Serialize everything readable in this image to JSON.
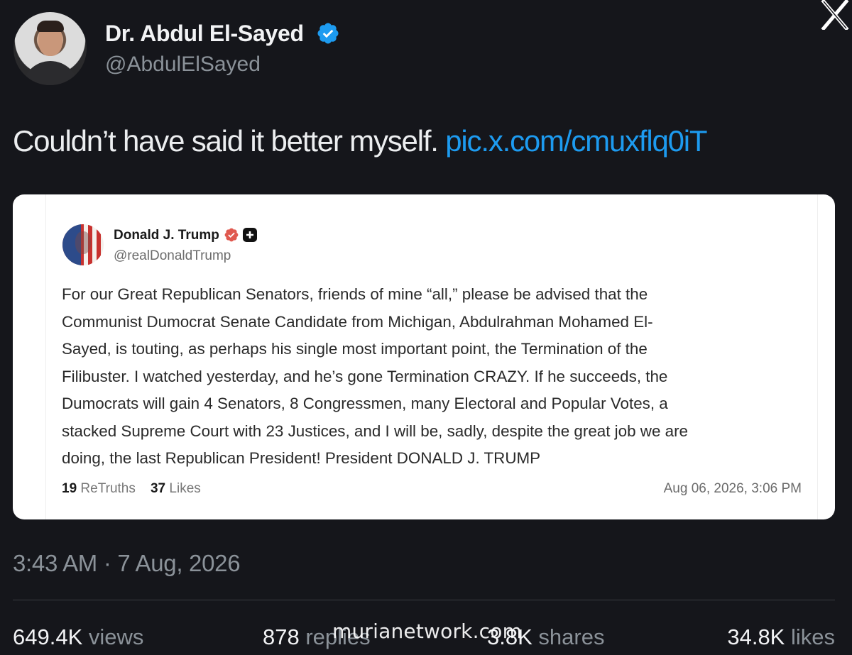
{
  "author": {
    "display_name": "Dr. Abdul El-Sayed",
    "handle": "@AbdulElSayed",
    "verified_icon": "verified-check-icon",
    "verified_color": "#1d9bf0"
  },
  "app_logo": "x-logo-icon",
  "tweet": {
    "text": "Couldn’t have said it better myself.",
    "link": "pic.x.com/cmuxflq0iT",
    "link_color": "#1d9bf0"
  },
  "embedded_post": {
    "display_name": "Donald J. Trump",
    "handle": "@realDonaldTrump",
    "badge_color": "#e0594f",
    "body_lines": [
      "For our Great Republican Senators, friends of mine “all,” please be advised that the",
      "Communist Dumocrat Senate Candidate from Michigan, Abdulrahman Mohamed El-",
      "Sayed, is touting, as perhaps his single most important point, the Termination of the",
      "Filibuster. I watched yesterday, and he’s gone Termination CRAZY. If he succeeds, the",
      "Dumocrats will gain 4 Senators, 8 Congressmen, many Electoral and Popular Votes, a",
      "stacked Supreme Court with 23 Justices, and I will be, sadly, despite the great job we are",
      "doing, the last Republican President! President DONALD J. TRUMP"
    ],
    "retruths_count": "19",
    "retruths_label": "ReTruths",
    "likes_count": "37",
    "likes_label": "Likes",
    "date": "Aug 06, 2026, 3:06 PM"
  },
  "timestamp": "3:43 AM · 7 Aug, 2026",
  "stats": {
    "views_count": "649.4K",
    "views_label": "views",
    "replies_count": "878",
    "replies_label": "replies",
    "shares_count": "3.8K",
    "shares_label": "shares",
    "likes_count": "34.8K",
    "likes_label": "likes"
  },
  "watermark": "murianetwork.com"
}
